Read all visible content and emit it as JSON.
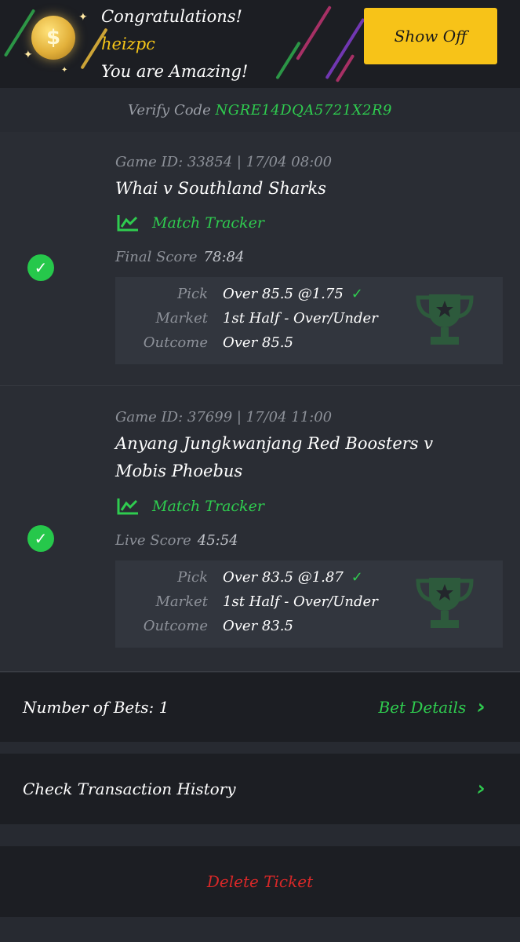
{
  "banner": {
    "line1": "Congratulations!",
    "username": "heizpc",
    "line3": "You are Amazing!",
    "show_off_label": "Show Off",
    "coin_symbol": "$",
    "accent_color": "#f7c318"
  },
  "verify": {
    "label": "Verify Code",
    "code": "NGRE14DQA5721X2R9"
  },
  "bets": [
    {
      "game_id_line": "Game ID: 33854 | 17/04 08:00",
      "teams": "Whai v Southland Sharks",
      "tracker_label": "Match Tracker",
      "score_label": "Final Score",
      "score_value": "78:84",
      "pick_label": "Pick",
      "pick_value": "Over 85.5 @1.75",
      "market_label": "Market",
      "market_value": "1st Half - Over/Under",
      "outcome_label": "Outcome",
      "outcome_value": "Over 85.5"
    },
    {
      "game_id_line": "Game ID: 37699 | 17/04 11:00",
      "teams": "Anyang Jungkwanjang Red Boosters v Mobis Phoebus",
      "tracker_label": "Match Tracker",
      "score_label": "Live Score",
      "score_value": "45:54",
      "pick_label": "Pick",
      "pick_value": "Over 83.5 @1.87",
      "market_label": "Market",
      "market_value": "1st Half - Over/Under",
      "outcome_label": "Outcome",
      "outcome_value": "Over 83.5"
    }
  ],
  "footer": {
    "number_of_bets": "Number of Bets: 1",
    "bet_details_label": "Bet Details",
    "check_history_label": "Check Transaction History",
    "delete_label": "Delete Ticket"
  },
  "icons": {
    "win_check": "check-circle-icon",
    "tracker": "chart-line-icon",
    "trophy": "trophy-icon",
    "chevron": "chevron-right-icon"
  },
  "colors": {
    "green": "#2fcc4f",
    "red": "#d72828",
    "background": "#272a31",
    "panel": "#1c1e23"
  }
}
